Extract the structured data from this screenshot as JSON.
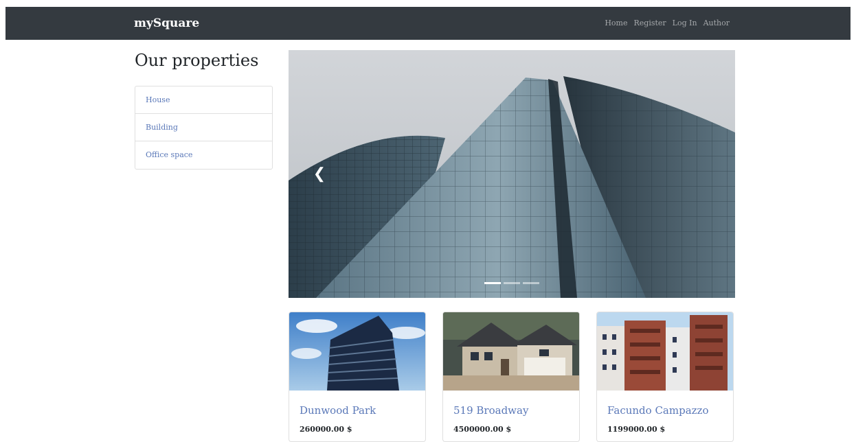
{
  "navbar": {
    "brand": "mySquare",
    "links": [
      "Home",
      "Register",
      "Log In",
      "Author"
    ]
  },
  "sidebar": {
    "title": "Our properties",
    "categories": [
      "House",
      "Building",
      "Office space"
    ]
  },
  "carousel": {
    "prev_icon": "chevron-left-icon",
    "slide_count": 3,
    "active_index": 0
  },
  "properties": [
    {
      "name": "Dunwood Park",
      "price": "260000.00 $"
    },
    {
      "name": "519 Broadway",
      "price": "4500000.00 $"
    },
    {
      "name": "Facundo Campazzo",
      "price": "1199000.00 $"
    }
  ],
  "colors": {
    "navbar_bg": "#343a40",
    "link": "#5a78b8"
  }
}
